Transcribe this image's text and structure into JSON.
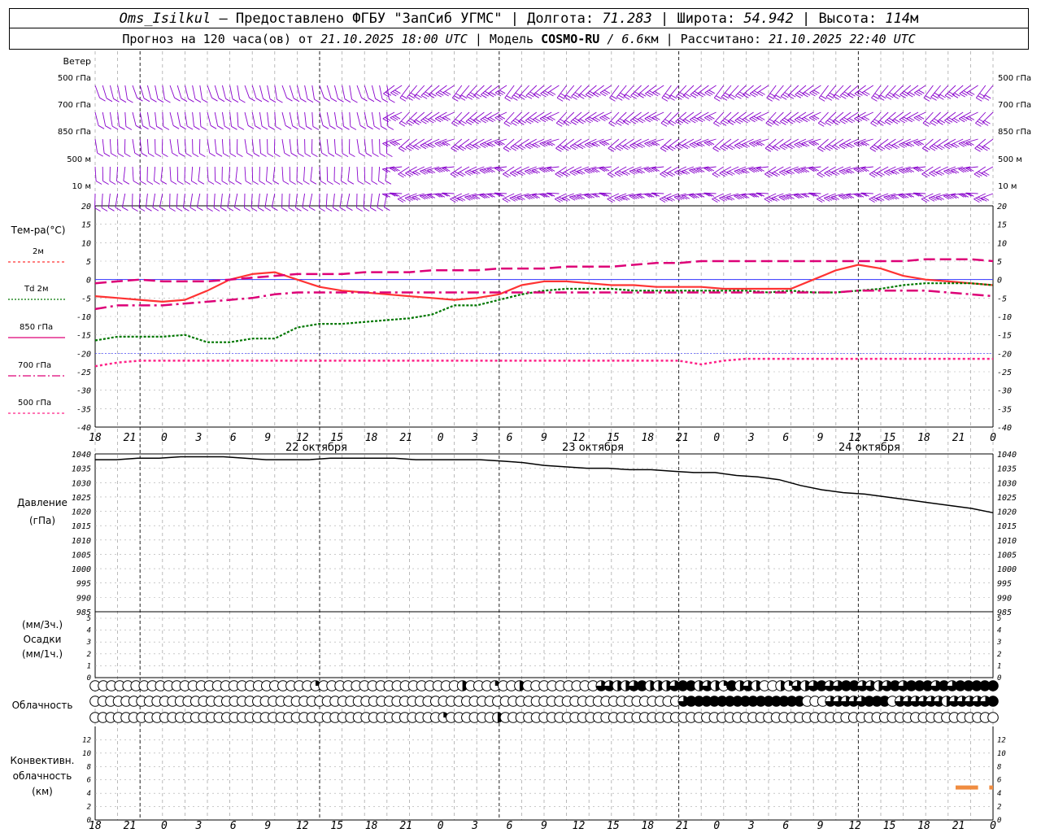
{
  "header": {
    "station": "Oms_Isilkul",
    "provided": "– Предоставлено ФГБУ \"ЗапСиб УГМС\"",
    "lon_label": "| Долгота:",
    "lon_value": "71.283",
    "lat_label": "| Широта:",
    "lat_value": "54.942",
    "alt_label": "| Высота:",
    "alt_value": "114",
    "alt_unit": "м",
    "forecast_label": "Прогноз на 120 часа(ов) от",
    "forecast_start": "21.10.2025 18:00 UTC",
    "model_label": "| Модель",
    "model_name": "COSMO-RU",
    "model_res": "/ 6.6",
    "model_res_unit": "км",
    "calc_label": "| Рассчитано:",
    "calc_time": "21.10.2025 22:40 UTC"
  },
  "colors": {
    "wind": "#8800cc",
    "t2m": "#ff3333",
    "td2m": "#007700",
    "t850": "#dd0077",
    "t700": "#dd0077",
    "t500": "#ff2288",
    "pressure": "#000000",
    "convective": "#f08c40",
    "zero_line": "#3333ff",
    "grid": "#aaaaaa"
  },
  "time_axis": {
    "hour_labels": [
      "18",
      "21",
      "0",
      "3",
      "6",
      "9",
      "12",
      "15",
      "18",
      "21",
      "0",
      "3",
      "6",
      "9",
      "12",
      "15",
      "18",
      "21",
      "0",
      "3",
      "6",
      "9",
      "12",
      "15",
      "18",
      "21",
      "0"
    ],
    "day_labels": [
      "22 октября",
      "23 октября",
      "24 октября"
    ]
  },
  "wind": {
    "title": "Ветер",
    "levels": [
      "500 гПа",
      "700 гПа",
      "850 гПа",
      "500 м",
      "10 м"
    ]
  },
  "chart_data": [
    {
      "type": "line",
      "title": "Тем-ра(°C)",
      "x": [
        0,
        3,
        6,
        9,
        12,
        15,
        18,
        21,
        24,
        27,
        30,
        33,
        36,
        39,
        42,
        45,
        48,
        51,
        54,
        57,
        60,
        63,
        66,
        69,
        72,
        75,
        78,
        81,
        84,
        87,
        90,
        93,
        96,
        99,
        102,
        105,
        108,
        111,
        114,
        117,
        120
      ],
      "ylim": [
        -40,
        20
      ],
      "yticks": [
        20,
        15,
        10,
        5,
        0,
        -5,
        -10,
        -15,
        -20,
        -25,
        -30,
        -35,
        -40
      ],
      "series": [
        {
          "name": "2м",
          "values": [
            -4.5,
            -5,
            -5.5,
            -6,
            -5.5,
            -3,
            0,
            1.5,
            2,
            0,
            -2,
            -3,
            -3.5,
            -4,
            -4.5,
            -5,
            -5.5,
            -5,
            -4,
            -1.5,
            -0.5,
            -0.5,
            -1,
            -1.5,
            -1.5,
            -2,
            -2,
            -2,
            -2.5,
            -2.5,
            -2.5,
            -2.5,
            0,
            2.5,
            4,
            3,
            1,
            0,
            -0.5,
            -1,
            -1.5
          ]
        },
        {
          "name": "Td 2м",
          "values": [
            -16.5,
            -15.5,
            -15.5,
            -15.5,
            -15,
            -17,
            -17,
            -16,
            -16,
            -13,
            -12,
            -12,
            -11.5,
            -11,
            -10.5,
            -9.5,
            -7,
            -7,
            -5.5,
            -4,
            -3,
            -2.5,
            -2.5,
            -2.5,
            -3,
            -3,
            -3,
            -3,
            -3,
            -3,
            -3.5,
            -3,
            -3.5,
            -3.5,
            -3,
            -2.5,
            -1.5,
            -1,
            -1,
            -1,
            -1.5
          ]
        },
        {
          "name": "850 гПа",
          "values": [
            -1,
            -0.5,
            0,
            -0.5,
            -0.5,
            -0.5,
            0,
            0.5,
            1,
            1.5,
            1.5,
            1.5,
            2,
            2,
            2,
            2.5,
            2.5,
            2.5,
            3,
            3,
            3,
            3.5,
            3.5,
            3.5,
            4,
            4.5,
            4.5,
            5,
            5,
            5,
            5,
            5,
            5,
            5,
            5,
            5,
            5,
            5.5,
            5.5,
            5.5,
            5
          ]
        },
        {
          "name": "700 гПа",
          "values": [
            -8,
            -7,
            -7,
            -7,
            -6.5,
            -6,
            -5.5,
            -5,
            -4,
            -3.5,
            -3.5,
            -3.5,
            -3.5,
            -3.5,
            -3.5,
            -3.5,
            -3.5,
            -3.5,
            -3.5,
            -3.5,
            -3.5,
            -3.5,
            -3.5,
            -3.5,
            -3.5,
            -3.5,
            -3.5,
            -3.5,
            -3.5,
            -3.5,
            -3.5,
            -3.5,
            -3.5,
            -3.5,
            -3,
            -3,
            -3,
            -3,
            -3.5,
            -4,
            -4.5
          ]
        },
        {
          "name": "500 гПа",
          "values": [
            -23.5,
            -22.5,
            -22,
            -22,
            -22,
            -22,
            -22,
            -22,
            -22,
            -22,
            -22,
            -22,
            -22,
            -22,
            -22,
            -22,
            -22,
            -22,
            -22,
            -22,
            -22,
            -22,
            -22,
            -22,
            -22,
            -22,
            -22,
            -23,
            -22,
            -21.5,
            -21.5,
            -21.5,
            -21.5,
            -21.5,
            -21.5,
            -21.5,
            -21.5,
            -21.5,
            -21.5,
            -21.5,
            -21.5
          ]
        }
      ]
    },
    {
      "type": "line",
      "title": "Давление",
      "ylabel": "(гПа)",
      "x": [
        0,
        3,
        6,
        9,
        12,
        15,
        18,
        21,
        24,
        27,
        30,
        33,
        36,
        39,
        42,
        45,
        48,
        51,
        54,
        57,
        60,
        63,
        66,
        69,
        72,
        75,
        78,
        81,
        84,
        87,
        90,
        93,
        96,
        99,
        102,
        105,
        108,
        111,
        114,
        117,
        120
      ],
      "ylim": [
        985,
        1040
      ],
      "yticks": [
        1040,
        1035,
        1030,
        1025,
        1020,
        1015,
        1010,
        1005,
        1000,
        995,
        990,
        985
      ],
      "series": [
        {
          "name": "Давление",
          "values": [
            1038,
            1038,
            1038.5,
            1038.5,
            1039,
            1039,
            1039,
            1038.5,
            1038,
            1038,
            1038,
            1038.5,
            1038.5,
            1038.5,
            1038.5,
            1038,
            1038,
            1038,
            1038,
            1037.5,
            1037,
            1036,
            1035.5,
            1035,
            1035,
            1034.5,
            1034.5,
            1034,
            1033.5,
            1033.5,
            1032.5,
            1032,
            1031,
            1029,
            1027.5,
            1026.5,
            1026,
            1025,
            1024,
            1023,
            1022,
            1021,
            1019.5
          ]
        }
      ]
    },
    {
      "type": "bar",
      "title": "Осадки",
      "ylabel_top": "(мм/3ч.)",
      "ylabel_bottom": "(мм/1ч.)",
      "ylim": [
        0,
        5
      ],
      "yticks": [
        5,
        4,
        3,
        2,
        1,
        0
      ],
      "values": []
    },
    {
      "type": "table",
      "title": "Облачность",
      "rows": [
        [
          0,
          0,
          0,
          0,
          0,
          0,
          0,
          0,
          0,
          0,
          0,
          0,
          0,
          0,
          0,
          0,
          0,
          0,
          0,
          0,
          0,
          0,
          0,
          0,
          0,
          0,
          0,
          1,
          0,
          0,
          0,
          0,
          0,
          0,
          0,
          0,
          0,
          0,
          0,
          0,
          0,
          0,
          0,
          0,
          0,
          2,
          0,
          0,
          0,
          1,
          0,
          0,
          2,
          0,
          0,
          0,
          0,
          0,
          0,
          0,
          0,
          0,
          3,
          3,
          2,
          2,
          3,
          4,
          2,
          2,
          2,
          3,
          4,
          4,
          2,
          3,
          2,
          1,
          4,
          2,
          3,
          2,
          0,
          0,
          2,
          1,
          3,
          2,
          3,
          4,
          3,
          3,
          4,
          4,
          3,
          3,
          2,
          3,
          4,
          3,
          4,
          4,
          4,
          3,
          4,
          3,
          4,
          4,
          4,
          4,
          4
        ],
        [
          0,
          0,
          0,
          0,
          0,
          0,
          0,
          0,
          0,
          0,
          0,
          0,
          0,
          0,
          0,
          0,
          0,
          0,
          0,
          0,
          0,
          0,
          0,
          0,
          0,
          0,
          0,
          0,
          0,
          0,
          0,
          0,
          0,
          0,
          0,
          0,
          0,
          0,
          0,
          0,
          0,
          0,
          0,
          0,
          0,
          0,
          0,
          0,
          0,
          0,
          0,
          0,
          0,
          0,
          0,
          0,
          0,
          0,
          0,
          0,
          0,
          0,
          0,
          0,
          0,
          0,
          0,
          0,
          0,
          0,
          0,
          0,
          0,
          0,
          0,
          0,
          3,
          4,
          4,
          4,
          4,
          4,
          4,
          4,
          4,
          4,
          4,
          4,
          4,
          4,
          4,
          4,
          0,
          0,
          0,
          3,
          3,
          3,
          3,
          3,
          4,
          4,
          4,
          0,
          3,
          3,
          3,
          3,
          3,
          3,
          2,
          3,
          3,
          3,
          3,
          3,
          4
        ],
        [
          0,
          0,
          0,
          0,
          0,
          0,
          0,
          0,
          0,
          0,
          0,
          0,
          0,
          0,
          0,
          0,
          0,
          0,
          0,
          0,
          0,
          0,
          0,
          0,
          0,
          0,
          0,
          0,
          0,
          0,
          0,
          0,
          0,
          0,
          0,
          0,
          0,
          0,
          0,
          0,
          0,
          0,
          0,
          0,
          0,
          1,
          0,
          0,
          0,
          0,
          0,
          0,
          2,
          0,
          0,
          0,
          0,
          0,
          0,
          0,
          0,
          0,
          0,
          0,
          0,
          0,
          0,
          0,
          0,
          0,
          0,
          0,
          0,
          0,
          0,
          0,
          0,
          0,
          0,
          0,
          0,
          0,
          0,
          0,
          0,
          0,
          0,
          0,
          0,
          0,
          0,
          0,
          0,
          0,
          0,
          0,
          0,
          0,
          0,
          0,
          0,
          0,
          0,
          0,
          0,
          0,
          0,
          0,
          0,
          0,
          0,
          0,
          0,
          0,
          0,
          0,
          0
        ]
      ]
    },
    {
      "type": "bar",
      "title": "Конвективн. облачность",
      "ylabel": "(км)",
      "ylim": [
        0,
        14
      ],
      "yticks": [
        12,
        10,
        8,
        6,
        4,
        2,
        0
      ],
      "segments": [
        {
          "x0": 115,
          "x1": 118,
          "y": 4.8
        },
        {
          "x0": 119.5,
          "x1": 120,
          "y": 4.8
        }
      ]
    }
  ],
  "temp_legend": [
    {
      "label": "2м"
    },
    {
      "label": "Td  2м"
    },
    {
      "label": "850 гПа"
    },
    {
      "label": "700 гПа"
    },
    {
      "label": "500 гПа"
    }
  ],
  "side_labels": {
    "temp": "Тем-ра(°C)",
    "pressure": "Давление",
    "pressure_unit": "(гПа)",
    "precip_3h": "(мм/3ч.)",
    "precip": "Осадки",
    "precip_1h": "(мм/1ч.)",
    "clouds": "Облачность",
    "conv1": "Конвективн.",
    "conv2": "облачность",
    "conv3": "(км)"
  }
}
